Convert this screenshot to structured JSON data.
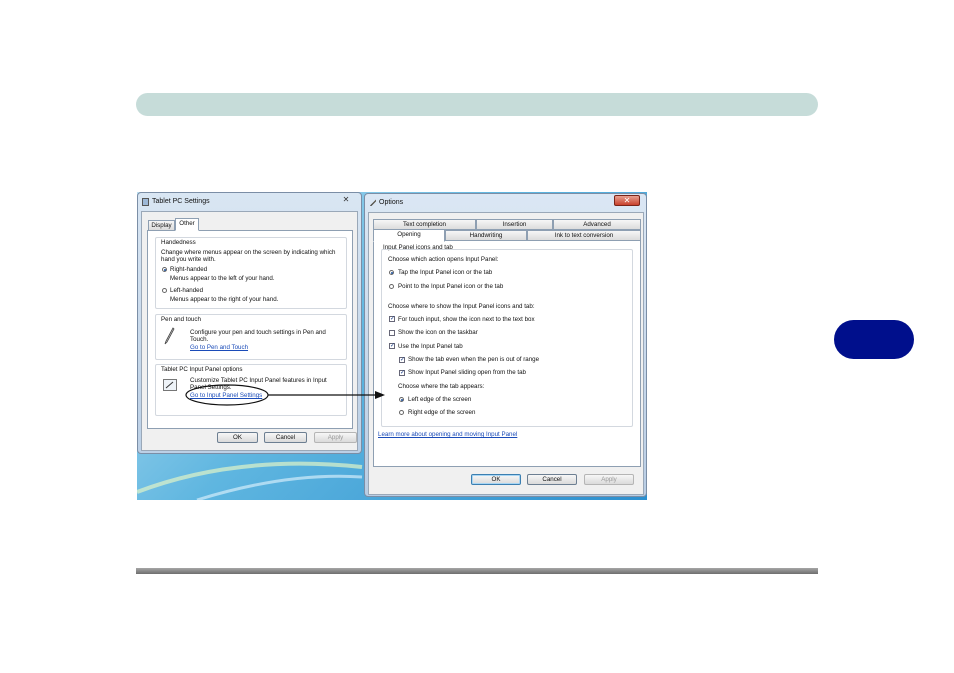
{
  "page": {
    "colors": {
      "header_bar": "#c6dcd9",
      "chapter_tab": "#000f8c",
      "footer_rule": "#808080"
    }
  },
  "tablet_pc_settings": {
    "title": "Tablet PC Settings",
    "close_icon": "close-icon",
    "tabs": [
      "Display",
      "Other"
    ],
    "active_tab": "Other",
    "handedness": {
      "heading": "Handedness",
      "description": "Change where menus appear on the screen by indicating which hand you write with.",
      "description_line1": "Change where menus appear on the screen by indicating which",
      "description_line2": "hand you write with.",
      "options": [
        {
          "label": "Right-handed",
          "note": "Menus appear to the left of your hand.",
          "selected": true
        },
        {
          "label": "Left-handed",
          "note": "Menus appear to the right of your hand.",
          "selected": false
        }
      ]
    },
    "pen_and_touch": {
      "heading": "Pen and touch",
      "icon": "pen-icon",
      "description_line1": "Configure your pen and touch settings in Pen and",
      "description_line2": "Touch.",
      "link": "Go to Pen and Touch"
    },
    "input_panel_options": {
      "heading": "Tablet PC Input Panel options",
      "icon": "input-panel-icon",
      "description_line1": "Customize Tablet PC Input Panel features in Input",
      "description_line2": "Panel Settings.",
      "link": "Go to Input Panel Settings"
    },
    "buttons": {
      "ok": "OK",
      "cancel": "Cancel",
      "apply": "Apply"
    }
  },
  "options": {
    "title": "Options",
    "close_icon": "close-icon",
    "tabs_row_back": [
      "Text completion",
      "Insertion",
      "Advanced"
    ],
    "tabs_row_front": [
      "Opening",
      "Handwriting",
      "Ink to text conversion"
    ],
    "active_tab": "Opening",
    "group_heading": "Input Panel icons and tab",
    "action_prompt": "Choose which action opens Input Panel:",
    "action_options": [
      {
        "label": "Tap the Input Panel icon or the tab",
        "selected": true
      },
      {
        "label": "Point to the Input Panel icon or the tab",
        "selected": false
      }
    ],
    "show_prompt": "Choose where to show the Input Panel icons and tab:",
    "checks": [
      {
        "label": "For touch input, show the icon next to the text box",
        "checked": true
      },
      {
        "label": "Show the icon on the taskbar",
        "checked": false
      },
      {
        "label": "Use the Input Panel tab",
        "checked": true
      }
    ],
    "sub_checks": [
      {
        "label": "Show the tab even when the pen is out of range",
        "checked": true
      },
      {
        "label": "Show Input Panel sliding open from the tab",
        "checked": true
      }
    ],
    "tab_prompt": "Choose where the tab appears:",
    "tab_options": [
      {
        "label": "Left edge of the screen",
        "selected": true
      },
      {
        "label": "Right edge of the screen",
        "selected": false
      }
    ],
    "learn_link": "Learn more about opening and moving Input Panel",
    "buttons": {
      "ok": "OK",
      "cancel": "Cancel",
      "apply": "Apply"
    }
  }
}
